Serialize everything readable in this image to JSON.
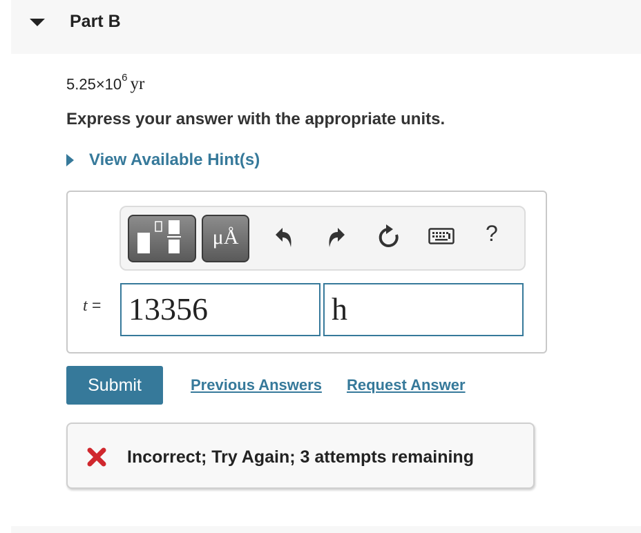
{
  "part": {
    "title": "Part B",
    "expanded": true
  },
  "question": {
    "given_mantissa": "5.25×10",
    "given_exponent": "6",
    "given_unit": "yr",
    "instruction": "Express your answer with the appropriate units."
  },
  "hint": {
    "label": "View Available Hint(s)"
  },
  "toolbar": {
    "templates_icon": "templates-icon",
    "units_glyph": "μÅ",
    "undo_icon": "undo-icon",
    "redo_icon": "redo-icon",
    "reset_icon": "reset-icon",
    "keyboard_icon": "keyboard-icon",
    "help_label": "?"
  },
  "answer": {
    "variable": "t",
    "equals": " =",
    "value": "13356",
    "unit": "h"
  },
  "actions": {
    "submit_label": "Submit",
    "previous_answers_label": "Previous Answers",
    "request_answer_label": "Request Answer"
  },
  "feedback": {
    "icon": "x-icon",
    "message": "Incorrect; Try Again; 3 attempts remaining",
    "color": "#d0282e"
  },
  "colors": {
    "accent": "#36799a",
    "header_bg": "#f7f7f7",
    "error": "#d0282e"
  }
}
